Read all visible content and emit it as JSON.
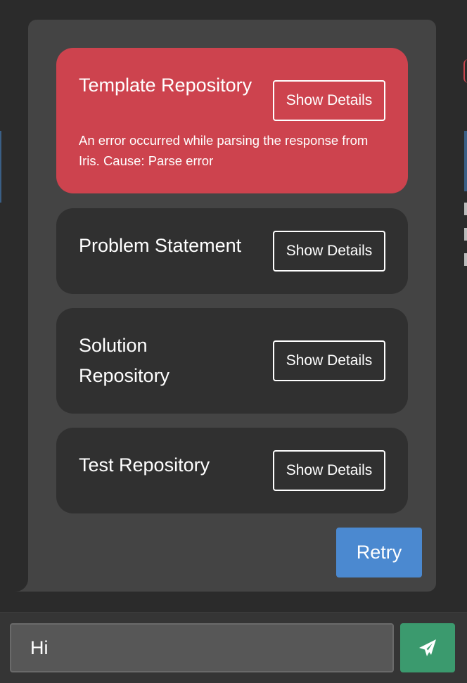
{
  "stages": [
    {
      "title": "Template Repository",
      "status": "error",
      "detail": "An error occurred while parsing the response from Iris. Cause: Parse error",
      "button_label": "Show Details"
    },
    {
      "title": "Problem Statement",
      "status": "default",
      "button_label": "Show Details"
    },
    {
      "title": "Solution Repository",
      "status": "default",
      "button_label": "Show Details"
    },
    {
      "title": "Test Repository",
      "status": "default",
      "button_label": "Show Details"
    }
  ],
  "retry_label": "Retry",
  "input": {
    "value": "Hi"
  },
  "send_icon": "paper-plane-icon",
  "colors": {
    "error": "#cd434e",
    "card": "#303030",
    "retry": "#4b89d0",
    "send": "#3b9a6e",
    "panel": "#444444",
    "background": "#2b2b2b"
  }
}
